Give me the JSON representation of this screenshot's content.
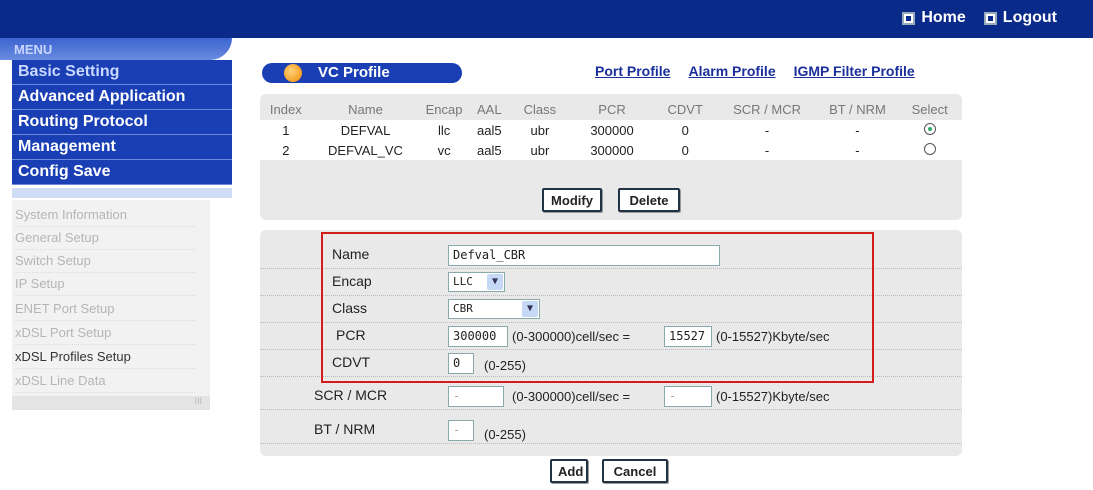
{
  "header": {
    "home_label": "Home",
    "logout_label": "Logout"
  },
  "menu": {
    "title": "MENU",
    "main": [
      "Basic Setting",
      "Advanced Application",
      "Routing Protocol",
      "Management",
      "Config Save"
    ],
    "sub": [
      "System Information",
      "General Setup",
      "Switch Setup",
      "IP Setup",
      "ENET Port Setup",
      "xDSL Port Setup",
      "xDSL Profiles Setup",
      "xDSL Line Data"
    ],
    "selected_sub": "xDSL Profiles Setup",
    "scroll_indicator": "III"
  },
  "page": {
    "title": "VC Profile",
    "links": [
      "Port Profile",
      "Alarm Profile",
      "IGMP Filter Profile"
    ]
  },
  "table": {
    "headers": [
      "Index",
      "Name",
      "Encap",
      "AAL",
      "Class",
      "PCR",
      "CDVT",
      "SCR / MCR",
      "BT / NRM",
      "Select"
    ],
    "rows": [
      {
        "index": "1",
        "name": "DEFVAL",
        "encap": "llc",
        "aal": "aal5",
        "class": "ubr",
        "pcr": "300000",
        "cdvt": "0",
        "scr": "-",
        "bt": "-",
        "selected": true
      },
      {
        "index": "2",
        "name": "DEFVAL_VC",
        "encap": "vc",
        "aal": "aal5",
        "class": "ubr",
        "pcr": "300000",
        "cdvt": "0",
        "scr": "-",
        "bt": "-",
        "selected": false
      }
    ]
  },
  "buttons": {
    "modify": "Modify",
    "delete": "Delete",
    "add": "Add",
    "cancel": "Cancel"
  },
  "form": {
    "name_label": "Name",
    "name_value": "Defval_CBR",
    "encap_label": "Encap",
    "encap_value": "LLC",
    "class_label": "Class",
    "class_value": "CBR",
    "pcr_label": "PCR",
    "pcr_value": "300000",
    "pcr_range": "(0-300000)cell/sec =",
    "pcr_kbyte_value": "15527",
    "pcr_kbyte_range": "(0-15527)Kbyte/sec",
    "cdvt_label": "CDVT",
    "cdvt_value": "0",
    "cdvt_range": "(0-255)",
    "scr_label": "SCR / MCR",
    "scr_value": "-",
    "scr_range": "(0-300000)cell/sec =",
    "scr_kbyte_value": "-",
    "scr_kbyte_range": "(0-15527)Kbyte/sec",
    "bt_label": "BT / NRM",
    "bt_value": "-",
    "bt_range": "(0-255)"
  },
  "colors": {
    "nav_bar": "#0a2a8a",
    "menu_blue": "#1a3fb5",
    "highlight_box": "#d21d1d"
  }
}
